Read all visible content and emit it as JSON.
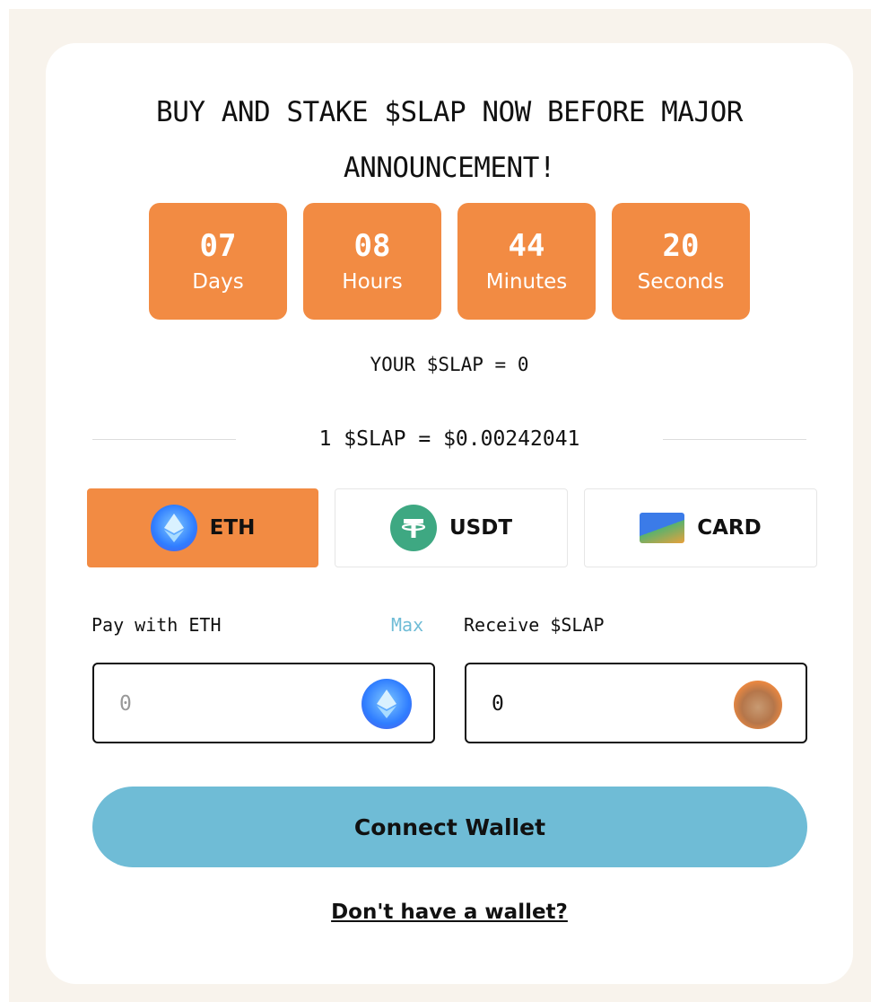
{
  "headline": "BUY AND STAKE $SLAP NOW BEFORE MAJOR ANNOUNCEMENT!",
  "countdown": [
    {
      "value": "07",
      "unit": "Days"
    },
    {
      "value": "08",
      "unit": "Hours"
    },
    {
      "value": "44",
      "unit": "Minutes"
    },
    {
      "value": "20",
      "unit": "Seconds"
    }
  ],
  "balance_text": "YOUR $SLAP = 0",
  "rate_text": "1 $SLAP = $0.00242041",
  "payment_tabs": [
    {
      "label": "ETH",
      "icon": "eth-icon",
      "active": true
    },
    {
      "label": "USDT",
      "icon": "usdt-icon",
      "active": false
    },
    {
      "label": "CARD",
      "icon": "credit-card-icon",
      "active": false
    }
  ],
  "pay": {
    "label": "Pay with ETH",
    "max_label": "Max",
    "placeholder": "0",
    "icon": "eth-icon"
  },
  "receive": {
    "label": "Receive $SLAP",
    "value": "0",
    "icon": "slap-token-icon"
  },
  "connect_label": "Connect Wallet",
  "no_wallet_label": "Don't have a wallet?",
  "colors": {
    "accent_orange": "#f28b43",
    "accent_blue": "#6fbcd6",
    "page_bg": "#f8f3ec"
  }
}
